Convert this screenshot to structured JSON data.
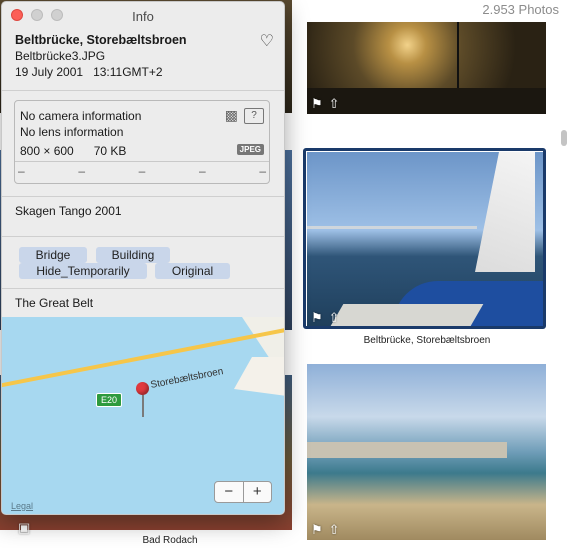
{
  "library": {
    "photo_count": "2.953 Photos",
    "captions": {
      "selected": "Beltbrücke, Storebæltsbroen",
      "left_bottom": "Bad Rodach"
    },
    "badge_icons": [
      "tag-icon",
      "share-icon"
    ],
    "selected_border_color": "#1a3a6a"
  },
  "info_window": {
    "title": "Info",
    "header": {
      "title": "Beltbrücke, Storebæltsbroen",
      "filename": "Beltbrücke3.JPG",
      "date": "19 July 2001",
      "time": "13:11GMT+2"
    },
    "camera": {
      "camera_info": "No camera information",
      "lens_info": "No lens information",
      "dimensions": "800 × 600",
      "file_size": "70 KB",
      "format_badge": "JPEG",
      "exif": [
        "–",
        "–",
        "–",
        "–",
        "–"
      ]
    },
    "description": "Skagen Tango 2001",
    "keywords": [
      "Bridge",
      "Building",
      "Hide_Temporarily",
      "Original"
    ],
    "location": {
      "place": "The Great Belt",
      "road_label": "Storebæltsbroen",
      "road_shield": "E20",
      "zoom_out": "−",
      "zoom_in": "+",
      "legal": "Legal"
    }
  }
}
